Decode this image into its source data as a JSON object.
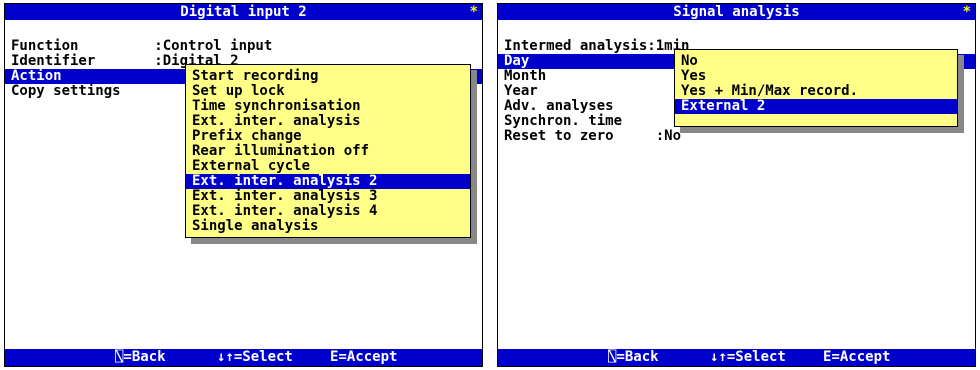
{
  "left": {
    "title": "Digital input  2",
    "star": "*",
    "rows": [
      "Function         :Control input",
      "Identifier       :Digital 2",
      "Action",
      "Copy settings"
    ],
    "popup": [
      "Start recording",
      "Set up lock",
      "Time synchronisation",
      "Ext. inter. analysis",
      "Prefix change",
      "Rear illumination off",
      "External cycle",
      "Ext. inter. analysis 2",
      "Ext. inter. analysis 3",
      "Ext. inter. analysis 4",
      "Single analysis"
    ],
    "footer": {
      "back": "⍂=Back",
      "select": "↓↑=Select",
      "accept": "E=Accept"
    }
  },
  "right": {
    "title": "Signal analysis",
    "star": "*",
    "rows": [
      "Intermed analysis:1min",
      "Day",
      "Month",
      "Year",
      "Adv. analyses",
      "Synchron. time",
      "Reset to zero     :No"
    ],
    "popup": [
      "No",
      "Yes",
      "Yes + Min/Max record.",
      "External 2"
    ],
    "footer": {
      "back": "⍂=Back",
      "select": "↓↑=Select",
      "accept": "E=Accept"
    }
  }
}
